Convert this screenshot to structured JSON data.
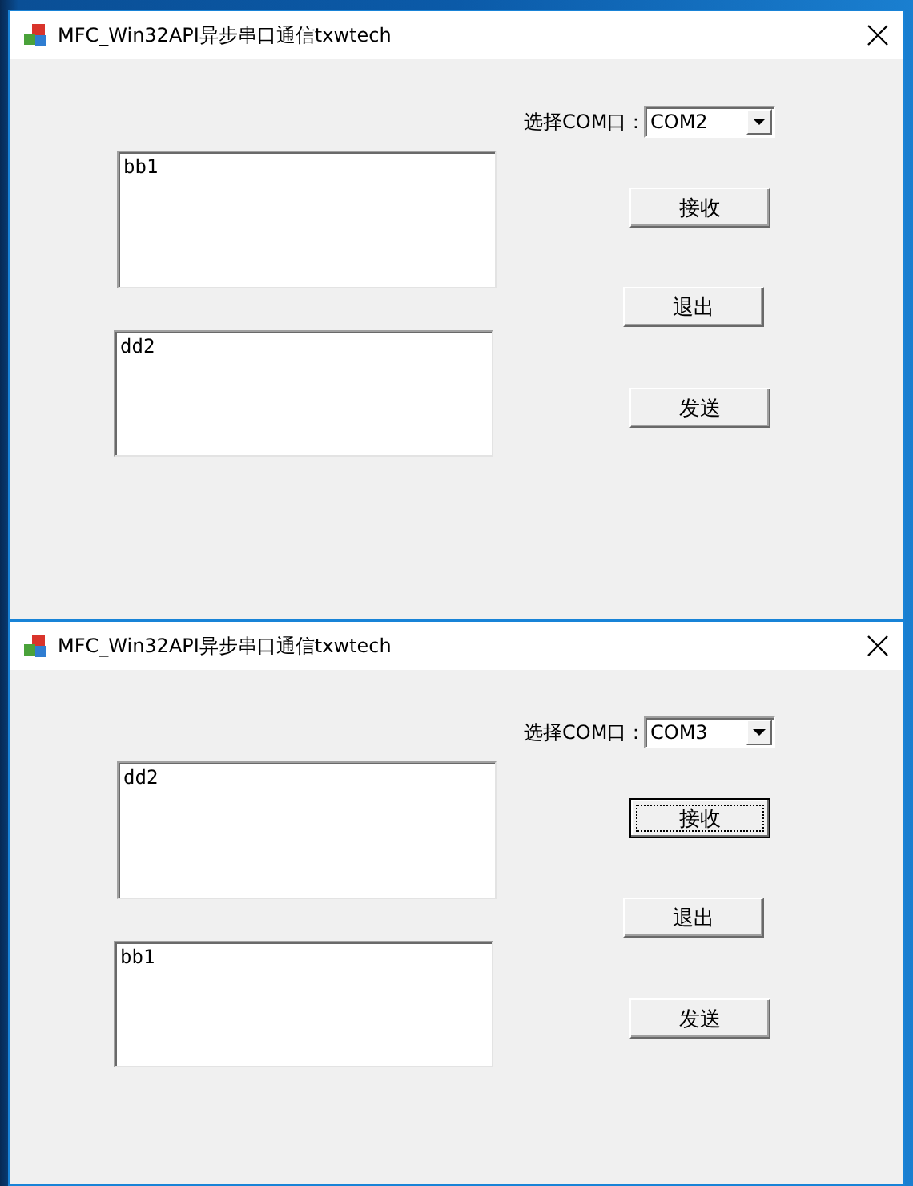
{
  "windows": [
    {
      "title": "MFC_Win32API异步串口通信txwtech",
      "combo_label": "选择COM口：",
      "combo": {
        "value": "COM2"
      },
      "text_boxes": [
        {
          "text": "bb1"
        },
        {
          "text": "dd2"
        }
      ],
      "buttons": [
        {
          "label": "接收",
          "focused": false
        },
        {
          "label": "退出",
          "focused": false
        },
        {
          "label": "发送",
          "focused": false
        }
      ]
    },
    {
      "title": "MFC_Win32API异步串口通信txwtech",
      "combo_label": "选择COM口：",
      "combo": {
        "value": "COM3"
      },
      "text_boxes": [
        {
          "text": "dd2"
        },
        {
          "text": "bb1"
        }
      ],
      "buttons": [
        {
          "label": "接收",
          "focused": true
        },
        {
          "label": "退出",
          "focused": false
        },
        {
          "label": "发送",
          "focused": false
        }
      ]
    }
  ]
}
